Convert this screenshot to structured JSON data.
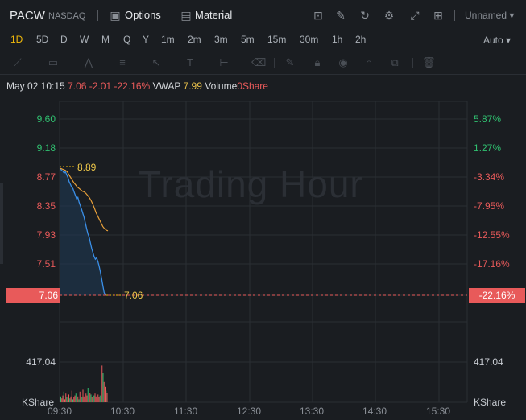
{
  "header": {
    "symbol": "PACW",
    "exchange": "NASDAQ",
    "options_label": "Options",
    "material_label": "Material",
    "layout_name": "Unnamed",
    "icons": [
      "options-icon",
      "material-icon",
      "indicator-icon",
      "draw-icon",
      "refresh-icon",
      "settings-icon",
      "fullscreen-icon",
      "layout-grid-icon"
    ]
  },
  "periods": [
    "1D",
    "5D",
    "D",
    "W",
    "M",
    "Q",
    "Y",
    "1m",
    "2m",
    "3m",
    "5m",
    "15m",
    "30m",
    "1h",
    "2h"
  ],
  "active_period": "1D",
  "scale_mode": "Auto",
  "info": {
    "datetime": "May 02 10:15",
    "price": "7.06",
    "change": "-2.01",
    "change_pct": "-22.16%",
    "vwap_label": "VWAP",
    "vwap_value": "7.99",
    "volume_label": "Volume",
    "volume_value": "0Share"
  },
  "watermark": "Trading Hour",
  "price_axis": [
    "9.60",
    "9.18",
    "8.77",
    "8.35",
    "7.93",
    "7.51"
  ],
  "pct_axis": [
    "5.87%",
    "1.27%",
    "-3.34%",
    "-7.95%",
    "-12.55%",
    "-17.16%"
  ],
  "current_price_tag": "7.06",
  "current_pct_tag": "-22.16%",
  "line_labels": {
    "open": "8.89",
    "last": "7.06"
  },
  "volume_axis": {
    "left_value": "417.04",
    "right_value": "417.04",
    "left_unit": "KShare",
    "right_unit": "KShare"
  },
  "time_axis": [
    "09:30",
    "10:30",
    "11:30",
    "12:30",
    "13:30",
    "14:30",
    "15:30"
  ],
  "colors": {
    "up": "#30c070",
    "down": "#e85a5a",
    "price_line": "#3a8ee6",
    "vwap_line": "#e8a03a",
    "accent": "#f0b90b"
  },
  "chart_data": {
    "type": "line",
    "price_series": [
      8.89,
      8.86,
      8.85,
      8.82,
      8.84,
      8.8,
      8.76,
      8.7,
      8.66,
      8.62,
      8.6,
      8.55,
      8.5,
      8.45,
      8.47,
      8.4,
      8.35,
      8.3,
      8.24,
      8.18,
      8.1,
      8.02,
      7.95,
      7.9,
      7.82,
      7.74,
      7.68,
      7.62,
      7.58,
      7.6,
      7.55,
      7.48,
      7.4,
      7.3,
      7.2,
      7.1,
      7.06
    ],
    "vwap_series": [
      8.89,
      8.88,
      8.87,
      8.86,
      8.84,
      8.8,
      8.76,
      8.72,
      8.68,
      8.65,
      8.62,
      8.6,
      8.58,
      8.56,
      8.55,
      8.53,
      8.5,
      8.47,
      8.43,
      8.38,
      8.32,
      8.25,
      8.2,
      8.15,
      8.1,
      8.05,
      8.02,
      8.0,
      7.99
    ],
    "ylim": [
      7.06,
      9.6
    ],
    "volume_ylim": [
      0,
      834
    ]
  }
}
